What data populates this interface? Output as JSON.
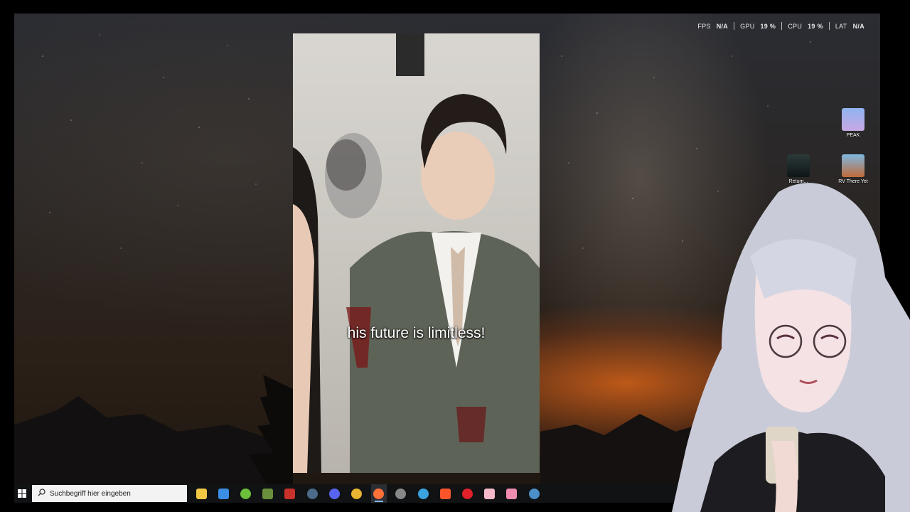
{
  "perf": {
    "fps_label": "FPS",
    "fps_value": "N/A",
    "gpu_label": "GPU",
    "gpu_value": "19 %",
    "cpu_label": "CPU",
    "cpu_value": "19 %",
    "lat_label": "LAT",
    "lat_value": "N/A"
  },
  "desktop_icons": [
    {
      "label": "PEAK",
      "icon": "peak-game-icon"
    },
    {
      "label": "Return...",
      "icon": "return-game-icon"
    },
    {
      "label": "RV There Yet",
      "icon": "rv-there-yet-game-icon"
    }
  ],
  "video": {
    "subtitle": "his future is limitless!"
  },
  "taskbar": {
    "search_placeholder": "Suchbegriff hier eingeben",
    "apps": [
      {
        "name": "file-explorer-icon",
        "color": "#f2c744"
      },
      {
        "name": "microsoft-store-icon",
        "color": "#3a8ee6"
      },
      {
        "name": "android-app-icon",
        "color": "#6bbf3b"
      },
      {
        "name": "minecraft-icon",
        "color": "#6a8f3c"
      },
      {
        "name": "snack-app-icon",
        "color": "#c8302a"
      },
      {
        "name": "steam-icon",
        "color": "#4c6b8a"
      },
      {
        "name": "discord-icon",
        "color": "#5865f2"
      },
      {
        "name": "chrome-icon",
        "color": "#e8b530"
      },
      {
        "name": "firefox-icon",
        "color": "#ff7139"
      },
      {
        "name": "speedometer-icon",
        "color": "#888888"
      },
      {
        "name": "refresh-app-icon",
        "color": "#3aa3e0"
      },
      {
        "name": "brave-icon",
        "color": "#fb542b"
      },
      {
        "name": "opera-icon",
        "color": "#e0202b"
      },
      {
        "name": "photo-app-icon",
        "color": "#f5b8c8"
      },
      {
        "name": "pink-app-icon",
        "color": "#f08cb0"
      },
      {
        "name": "steam-icon-2",
        "color": "#4c8fc9"
      }
    ]
  }
}
